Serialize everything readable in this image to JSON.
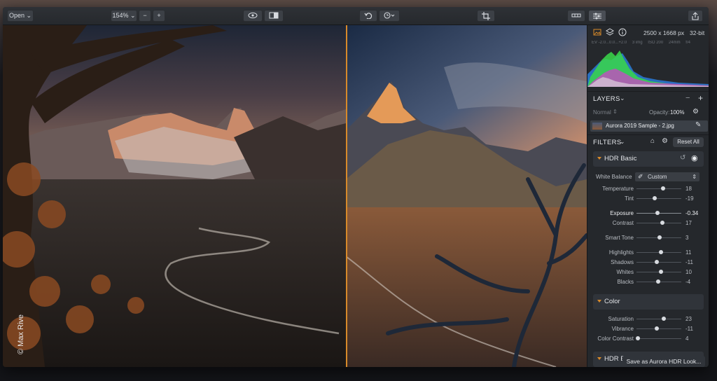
{
  "toolbar": {
    "open_label": "Open",
    "zoom_value": "154%",
    "zoom_minus": "−",
    "zoom_plus": "+"
  },
  "canvas": {
    "photo_credit": "© Max Rive"
  },
  "panel": {
    "image_dims": "2500 x 1668 px",
    "bit_depth": "32-bit",
    "exif": [
      "EV -2.0...0.0...+2.0",
      "3 img",
      "ISO 200",
      "24mm",
      "f/4"
    ],
    "layers": {
      "title": "LAYERS",
      "blend_mode": "Normal",
      "opacity_label": "Opacity:",
      "opacity_value": "100%",
      "layer_name": "Aurora 2019 Sample - 2.jpg"
    },
    "filters": {
      "title": "FILTERS",
      "reset_label": "Reset All",
      "hdr_basic": {
        "title": "HDR Basic",
        "white_balance_label": "White Balance",
        "white_balance_value": "Custom",
        "sliders": [
          {
            "label": "Temperature",
            "value": "18",
            "pos": 0.59
          },
          {
            "label": "Tint",
            "value": "-19",
            "pos": 0.41
          },
          {
            "label": "Exposure",
            "value": "-0.34",
            "pos": 0.47
          },
          {
            "label": "Contrast",
            "value": "17",
            "pos": 0.58
          },
          {
            "label": "Smart Tone",
            "value": "3",
            "pos": 0.52
          },
          {
            "label": "Highlights",
            "value": "11",
            "pos": 0.55
          },
          {
            "label": "Shadows",
            "value": "-11",
            "pos": 0.45
          },
          {
            "label": "Whites",
            "value": "10",
            "pos": 0.55
          },
          {
            "label": "Blacks",
            "value": "-4",
            "pos": 0.48
          }
        ]
      },
      "color": {
        "title": "Color",
        "sliders": [
          {
            "label": "Saturation",
            "value": "23",
            "pos": 0.61
          },
          {
            "label": "Vibrance",
            "value": "-11",
            "pos": 0.45
          },
          {
            "label": "Color Contrast",
            "value": "4",
            "pos": 0.03
          }
        ]
      },
      "hdr_enhance": {
        "title": "HDR Enhance"
      }
    },
    "save_label": "Save as Aurora HDR Look..."
  },
  "colors": {
    "accent": "#d88a2a",
    "panel_bg": "#25282c",
    "toolbar_bg": "#2b2e33"
  }
}
